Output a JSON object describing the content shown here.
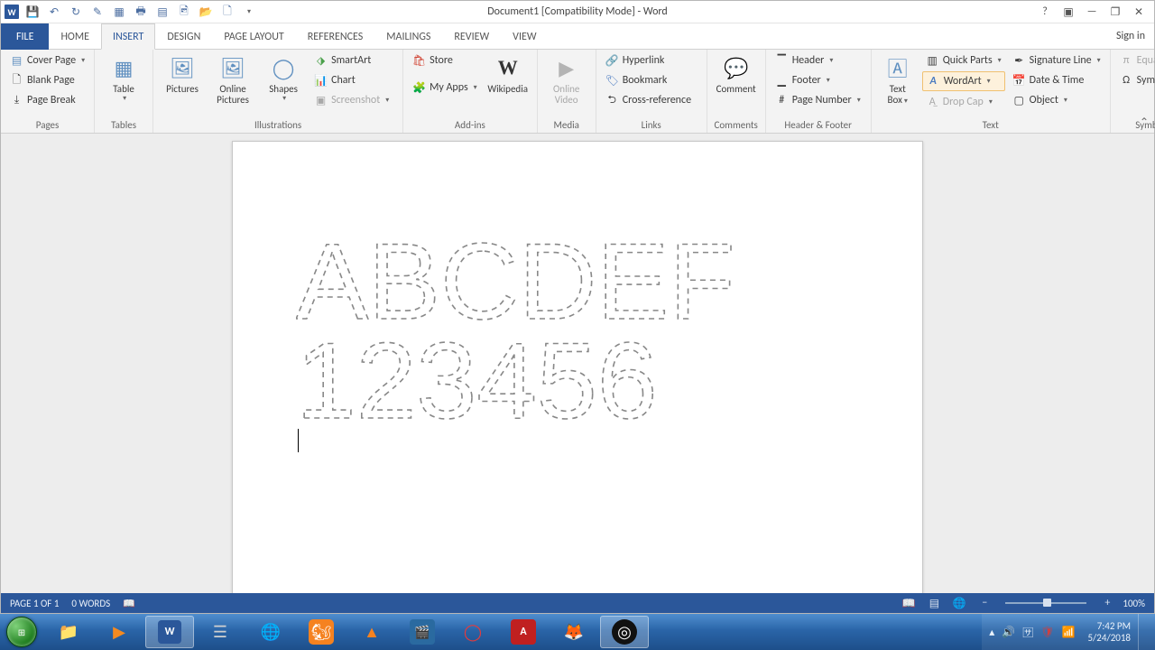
{
  "title": "Document1 [Compatibility Mode] - Word",
  "tabs": {
    "file": "FILE",
    "list": [
      "HOME",
      "INSERT",
      "DESIGN",
      "PAGE LAYOUT",
      "REFERENCES",
      "MAILINGS",
      "REVIEW",
      "VIEW"
    ],
    "active_index": 1,
    "signin": "Sign in"
  },
  "ribbon": {
    "pages": {
      "label": "Pages",
      "cover": "Cover Page",
      "blank": "Blank Page",
      "break": "Page Break"
    },
    "tables": {
      "label": "Tables",
      "table": "Table"
    },
    "illustrations": {
      "label": "Illustrations",
      "pictures": "Pictures",
      "online_pictures_l1": "Online",
      "online_pictures_l2": "Pictures",
      "shapes": "Shapes",
      "smartart": "SmartArt",
      "chart": "Chart",
      "screenshot": "Screenshot"
    },
    "addins": {
      "label": "Add-ins",
      "store": "Store",
      "myapps": "My Apps",
      "wikipedia": "Wikipedia"
    },
    "media": {
      "label": "Media",
      "video_l1": "Online",
      "video_l2": "Video"
    },
    "links": {
      "label": "Links",
      "hyperlink": "Hyperlink",
      "bookmark": "Bookmark",
      "crossref": "Cross-reference"
    },
    "comments": {
      "label": "Comments",
      "comment": "Comment"
    },
    "header_footer": {
      "label": "Header & Footer",
      "header": "Header",
      "footer": "Footer",
      "pagenum": "Page Number"
    },
    "text": {
      "label": "Text",
      "textbox_l1": "Text",
      "textbox_l2": "Box",
      "quickparts": "Quick Parts",
      "wordart": "WordArt",
      "dropcap": "Drop Cap",
      "sigline": "Signature Line",
      "datetime": "Date & Time",
      "object": "Object"
    },
    "symbols": {
      "label": "Symbols",
      "equation": "Equation",
      "symbol": "Symbol"
    }
  },
  "document": {
    "line1": "ABCDEF",
    "line2": "123456"
  },
  "status": {
    "page": "PAGE 1 OF 1",
    "words": "0 WORDS",
    "zoom": "100%"
  },
  "taskbar": {
    "time": "7:42 PM",
    "date": "5/24/2018"
  }
}
